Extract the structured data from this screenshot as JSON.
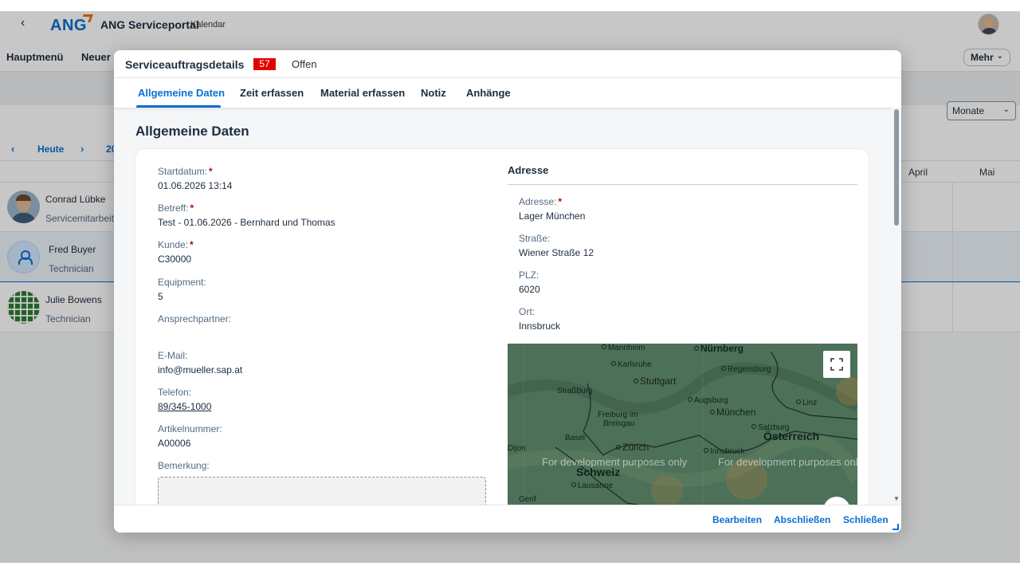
{
  "shell": {
    "logo": "ANG",
    "title": "ANG Serviceportal",
    "subtitle": "Kalendar"
  },
  "menubar": {
    "items": [
      "Hauptmenü",
      "Neuer S"
    ],
    "more": "Mehr"
  },
  "calendar": {
    "view_select": "Monate",
    "today": "Heute",
    "year": "20",
    "months": [
      "April",
      "Mai"
    ]
  },
  "people": [
    {
      "name": "Conrad Lübke",
      "role": "Servicemitarbeit"
    },
    {
      "name": "Fred Buyer",
      "role": "Technician"
    },
    {
      "name": "Julie Bowens",
      "role": "Technician"
    }
  ],
  "dialog": {
    "title": "Serviceauftragsdetails",
    "badge": "57",
    "status": "Offen",
    "tabs": [
      "Allgemeine Daten",
      "Zeit erfassen",
      "Material erfassen",
      "Notiz",
      "Anhänge"
    ],
    "section_title": "Allgemeine Daten",
    "fields": {
      "startdatum": {
        "label": "Startdatum:",
        "value": "01.06.2026 13:14"
      },
      "betreff": {
        "label": "Betreff:",
        "value": "Test - 01.06.2026 - Bernhard und Thomas"
      },
      "kunde": {
        "label": "Kunde:",
        "value": "C30000"
      },
      "equipment": {
        "label": "Equipment:",
        "value": "5"
      },
      "ansprechpartner": {
        "label": "Ansprechpartner:",
        "value": ""
      },
      "email": {
        "label": "E-Mail:",
        "value": "info@mueller.sap.at"
      },
      "telefon": {
        "label": "Telefon:",
        "value": "89/345-1000"
      },
      "artikelnummer": {
        "label": "Artikelnummer:",
        "value": "A00006"
      },
      "bemerkung": {
        "label": "Bemerkung:",
        "value": ""
      }
    },
    "address": {
      "title": "Adresse",
      "adresse": {
        "label": "Adresse:",
        "value": "Lager München"
      },
      "strasse": {
        "label": "Straße:",
        "value": "Wiener Straße 12"
      },
      "plz": {
        "label": "PLZ:",
        "value": "6020"
      },
      "ort": {
        "label": "Ort:",
        "value": "Innsbruck"
      }
    },
    "map": {
      "cities": [
        "Mannheim",
        "Nürnberg",
        "Karlsruhe",
        "Regensburg",
        "Stuttgart",
        "Straßburg",
        "Augsburg",
        "Linz",
        "München",
        "Freiburg im",
        "Breisgau",
        "Salzburg",
        "Basel",
        "Zürich",
        "Österreich",
        "Dijon",
        "Innsbruck",
        "Schweiz",
        "Lausanne",
        "Genf"
      ],
      "watermark": "For development purposes only"
    },
    "footer": {
      "edit": "Bearbeiten",
      "complete": "Abschließen",
      "close": "Schließen"
    }
  }
}
